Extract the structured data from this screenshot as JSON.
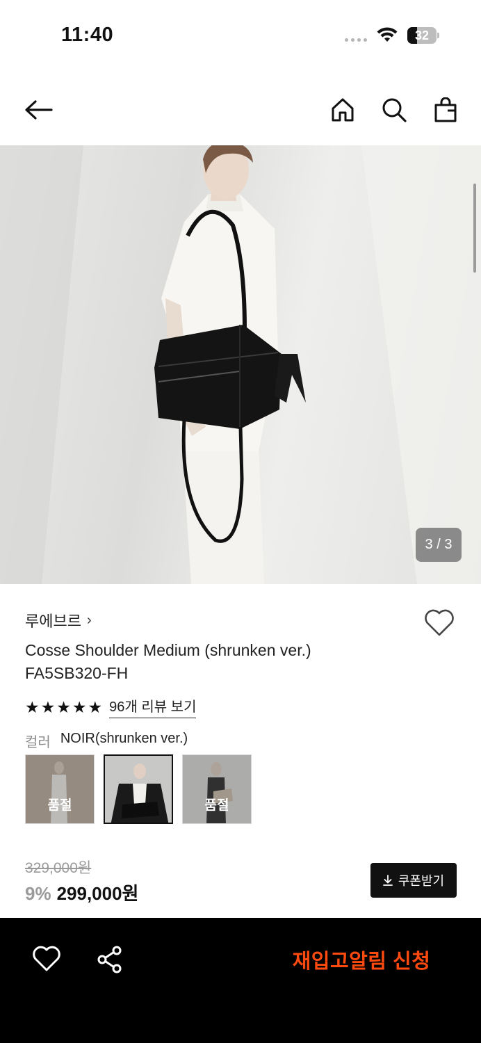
{
  "status_bar": {
    "time": "11:40",
    "battery": "32"
  },
  "nav": {
    "back_icon": "arrow-left-icon",
    "home_icon": "home-icon",
    "search_icon": "search-icon",
    "bag_icon": "shopping-bag-icon"
  },
  "gallery": {
    "counter": "3 / 3"
  },
  "product": {
    "brand": "루에브르",
    "brand_chevron": "›",
    "name": "Cosse Shoulder Medium (shrunken ver.)",
    "code": "FA5SB320-FH",
    "rating_stars": 5,
    "review_link": "96개 리뷰 보기",
    "color_label": "컬러",
    "color_value": "NOIR(shrunken ver.)",
    "swatches": [
      {
        "status": "품절"
      },
      {
        "status": ""
      },
      {
        "status": "품절"
      }
    ]
  },
  "price": {
    "original": "329,000원",
    "discount": "9%",
    "current": "299,000원"
  },
  "coupon": {
    "label": "쿠폰받기"
  },
  "bottom_bar": {
    "restock_label": "재입고알림 신청"
  },
  "colors": {
    "accent": "#ff4a0f",
    "bottom_bar_bg": "#000000"
  }
}
